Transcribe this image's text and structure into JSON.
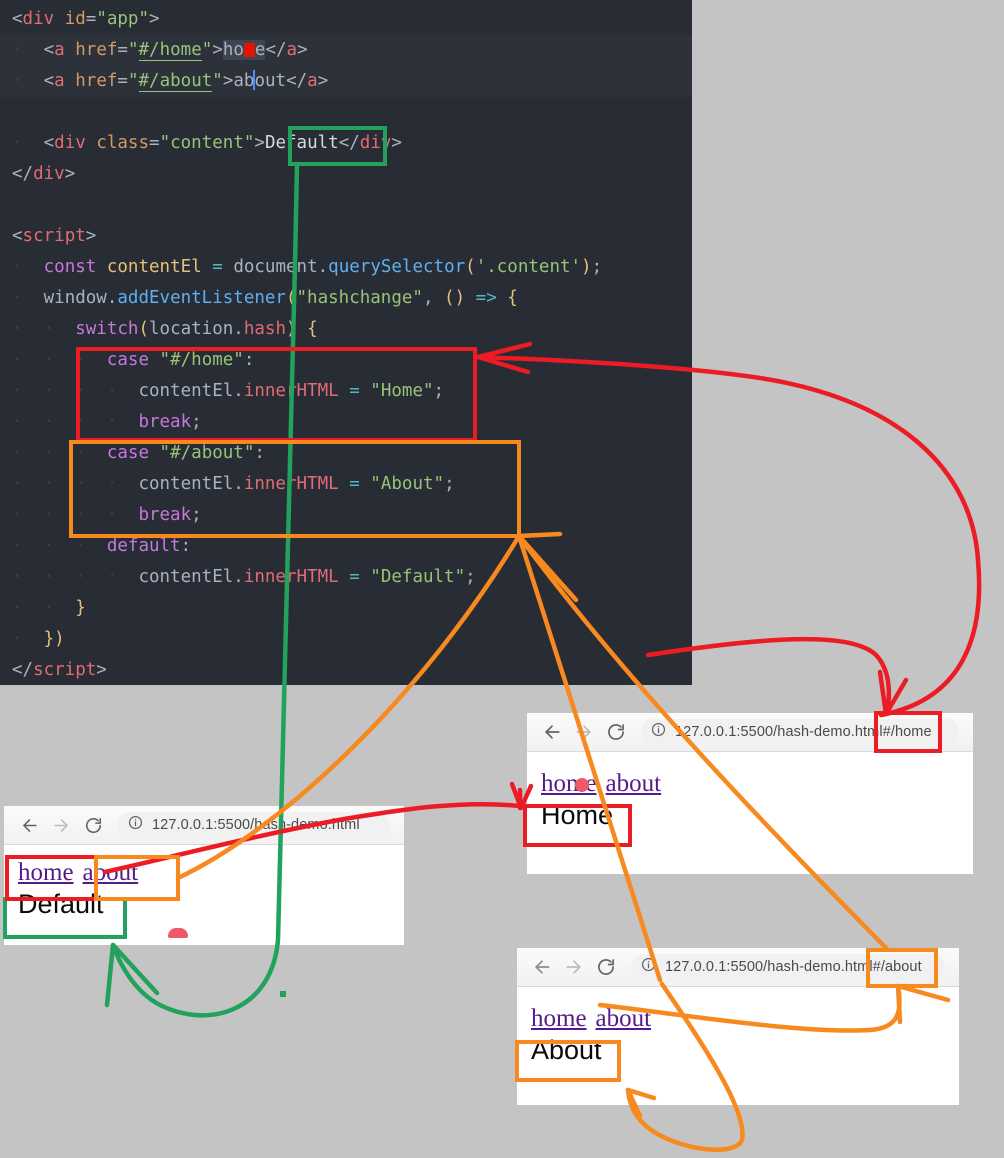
{
  "editor": {
    "name": "code-editor-panel",
    "language": "html",
    "theme_bg": "#282c34",
    "lines": [
      "<div id=\"app\">",
      "  <a href=\"#/home\">home</a>",
      "  <a href=\"#/about\">about</a>",
      "",
      "  <div class=\"content\">Default</div>",
      "</div>",
      "",
      "<script>",
      "  const contentEl = document.querySelector('.content');",
      "  window.addEventListener(\"hashchange\", () => {",
      "    switch(location.hash) {",
      "      case \"#/home\":",
      "        contentEl.innerHTML = \"Home\";",
      "        break;",
      "      case \"#/about\":",
      "        contentEl.innerHTML = \"About\";",
      "        break;",
      "      default:",
      "        contentEl.innerHTML = \"Default\";",
      "    }",
      "  })",
      "</script>"
    ]
  },
  "browsers": {
    "default_window": {
      "name": "browser-window-default",
      "url": "127.0.0.1:5500/hash-demo.html",
      "links": [
        "home",
        "about"
      ],
      "content": "Default"
    },
    "home_window": {
      "name": "browser-window-home",
      "url_base": "127.0.0.1:5500/hash-demo.html",
      "url_hash": "#/home",
      "url": "127.0.0.1:5500/hash-demo.html#/home",
      "links": [
        "home",
        "about"
      ],
      "content": "Home"
    },
    "about_window": {
      "name": "browser-window-about",
      "url_base": "127.0.0.1:5500/hash-demo.htm",
      "url_hash": "#/about",
      "url": "127.0.0.1:5500/hash-demo.html#/about",
      "links": [
        "home",
        "about"
      ],
      "content": "About"
    }
  },
  "toolbar": {
    "back_icon": "arrow-left-icon",
    "forward_icon": "arrow-right-icon",
    "reload_icon": "reload-icon",
    "info_icon": "info-circle-icon"
  },
  "annotations": {
    "green": {
      "color": "#22a25c",
      "label": "default-case-mapping",
      "source_box": "editor-default-literal",
      "target_box": "browser-default-content"
    },
    "red": {
      "color": "#ec1c24",
      "label": "home-case-mapping",
      "source_box": "editor-case-home-block",
      "target_boxes": [
        "browser-home-hash",
        "browser-home-content",
        "browser-default-home-link"
      ]
    },
    "orange": {
      "color": "#f7891f",
      "label": "about-case-mapping",
      "source_box": "editor-case-about-block",
      "target_boxes": [
        "browser-about-hash",
        "browser-about-content",
        "browser-default-about-link"
      ]
    }
  }
}
